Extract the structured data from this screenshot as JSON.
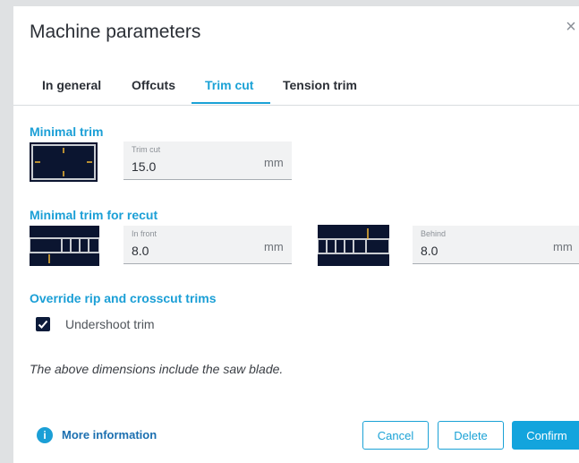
{
  "dialog": {
    "title": "Machine parameters"
  },
  "tabs": [
    {
      "label": "In general",
      "active": false
    },
    {
      "label": "Offcuts",
      "active": false
    },
    {
      "label": "Trim cut",
      "active": true
    },
    {
      "label": "Tension trim",
      "active": false
    }
  ],
  "minimal_trim": {
    "title": "Minimal trim",
    "field": {
      "label": "Trim cut",
      "value": "15.0",
      "unit": "mm"
    }
  },
  "recut": {
    "title": "Minimal trim for recut",
    "front": {
      "label": "In front",
      "value": "8.0",
      "unit": "mm"
    },
    "behind": {
      "label": "Behind",
      "value": "8.0",
      "unit": "mm"
    }
  },
  "override": {
    "title": "Override rip and crosscut trims",
    "checkbox_label": "Undershoot trim",
    "checked": true
  },
  "note": "The above dimensions include the saw blade.",
  "footer": {
    "more_info": "More information",
    "cancel": "Cancel",
    "delete": "Delete",
    "confirm": "Confirm"
  },
  "colors": {
    "accent": "#1ba2d6",
    "thumb_bg": "#0b1530",
    "marker": "#f2b632"
  }
}
